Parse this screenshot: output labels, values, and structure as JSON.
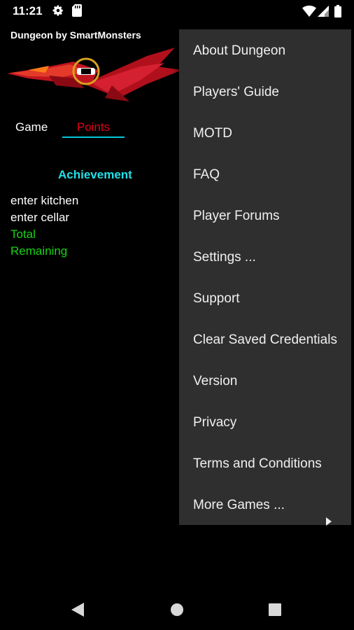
{
  "status": {
    "time": "11:21"
  },
  "app": {
    "title": "Dungeon by SmartMonsters"
  },
  "tabs": [
    {
      "label": "Game"
    },
    {
      "label": "Points"
    }
  ],
  "points": {
    "header": "Achievement",
    "rows": [
      {
        "label": "enter kitchen"
      },
      {
        "label": "enter cellar"
      },
      {
        "label": "Total"
      },
      {
        "label": "Remaining"
      }
    ]
  },
  "menu": {
    "items": [
      {
        "label": "About Dungeon"
      },
      {
        "label": "Players' Guide"
      },
      {
        "label": "MOTD"
      },
      {
        "label": "FAQ"
      },
      {
        "label": "Player Forums"
      },
      {
        "label": "Settings ..."
      },
      {
        "label": "Support"
      },
      {
        "label": "Clear Saved Credentials"
      },
      {
        "label": "Version"
      },
      {
        "label": "Privacy"
      },
      {
        "label": "Terms and Conditions"
      },
      {
        "label": "More Games ..."
      }
    ]
  },
  "icons": {
    "status": [
      "gear-icon",
      "sd-card-icon",
      "wifi-icon",
      "signal-icon",
      "battery-icon"
    ],
    "nav": [
      "back-icon",
      "home-icon",
      "recents-icon"
    ],
    "submenu": "chevron-right-icon"
  },
  "colors": {
    "background": "#000000",
    "menu_background": "#2f2f2f",
    "active_tab": "#e0001a",
    "tab_indicator": "#00c8d8",
    "achievement_header": "#21e0e8",
    "total_rows": "#18d414"
  }
}
